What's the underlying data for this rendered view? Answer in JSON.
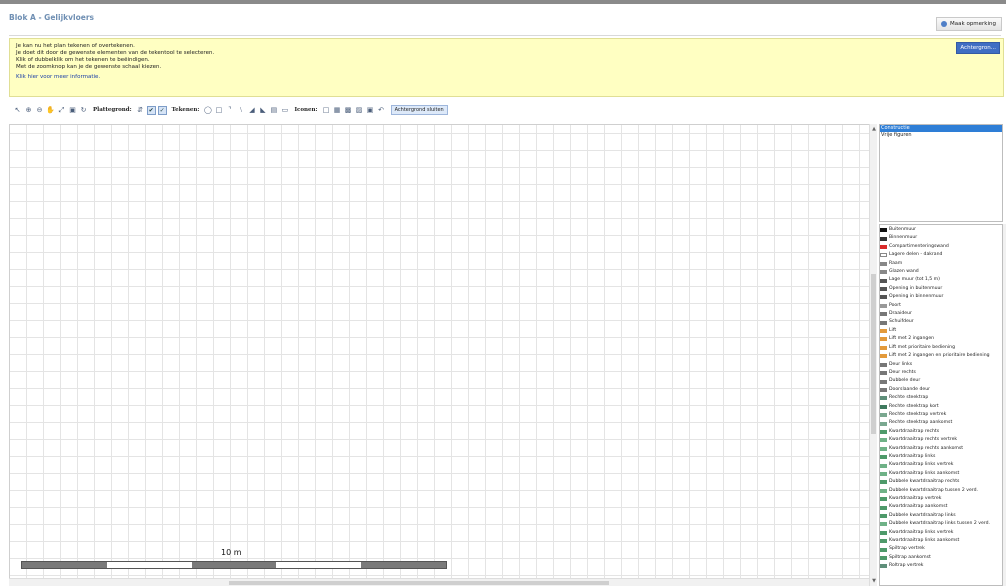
{
  "header": {
    "title": "Blok A - Gelijkvloers",
    "note_button": "Maak opmerking"
  },
  "info": {
    "lines": [
      "Je kan nu het plan tekenen of overtekenen.",
      "Je doet dit door de gewenste elementen van de tekentool te selecteren.",
      "Klik of dubbelklik om het tekenen te beëindigen.",
      "Met de zoomknop kan je de gewenste schaal kiezen."
    ],
    "more_link": "Klik hier voor meer informatie.",
    "background_button": "Achtergron..."
  },
  "toolbar": {
    "floorplan_label": "Plattegrond:",
    "draw_label": "Tekenen:",
    "icons_label": "Iconen:",
    "close_background_button": "Achtergrond sluiten"
  },
  "canvas": {
    "scale_label": "10 m"
  },
  "categories": [
    {
      "label": "Constructie",
      "selected": true
    },
    {
      "label": "Vrije figuren",
      "selected": false
    }
  ],
  "elements": [
    {
      "label": "Buitenmuur",
      "color": "#111111"
    },
    {
      "label": "Binnenmuur",
      "color": "#333333"
    },
    {
      "label": "Compartimenteringswand",
      "color": "#d92b2b"
    },
    {
      "label": "Lagere delen - dakrand",
      "color": "#ffffff"
    },
    {
      "label": "Raam",
      "color": "#888888"
    },
    {
      "label": "Glazen wand",
      "color": "#888888"
    },
    {
      "label": "Lage muur (tot 1,5 m)",
      "color": "#555555"
    },
    {
      "label": "Opening in buitenmuur",
      "color": "#555555"
    },
    {
      "label": "Opening in binnenmuur",
      "color": "#555555"
    },
    {
      "label": "Poort",
      "color": "#999999"
    },
    {
      "label": "Draaideur",
      "color": "#777777"
    },
    {
      "label": "Schuifdeur",
      "color": "#777777"
    },
    {
      "label": "Lift",
      "color": "#e39a3b"
    },
    {
      "label": "Lift met 2 ingangen",
      "color": "#e39a3b"
    },
    {
      "label": "Lift met prioritaire bediening",
      "color": "#e39a3b"
    },
    {
      "label": "Lift met 2 ingangen en prioritaire bediening",
      "color": "#e39a3b"
    },
    {
      "label": "Deur links",
      "color": "#777777"
    },
    {
      "label": "Deur rechts",
      "color": "#777777"
    },
    {
      "label": "Dubbele deur",
      "color": "#777777"
    },
    {
      "label": "Doorslaande deur",
      "color": "#777777"
    },
    {
      "label": "Rechte steektrap",
      "color": "#5f8f7a"
    },
    {
      "label": "Rechte steektrap kort",
      "color": "#3f7a5f"
    },
    {
      "label": "Rechte steektrap vertrek",
      "color": "#7aa890"
    },
    {
      "label": "Rechte steektrap aankomst",
      "color": "#7aa890"
    },
    {
      "label": "Kwartdraaitrap rechts",
      "color": "#4e9a6a"
    },
    {
      "label": "Kwartdraaitrap rechts vertrek",
      "color": "#6fb287"
    },
    {
      "label": "Kwartdraaitrap rechts aankomst",
      "color": "#6fb287"
    },
    {
      "label": "Kwartdraaitrap links",
      "color": "#4e9a6a"
    },
    {
      "label": "Kwartdraaitrap links vertrek",
      "color": "#6fb287"
    },
    {
      "label": "Kwartdraaitrap links aankomst",
      "color": "#6fb287"
    },
    {
      "label": "Dubbele kwartdraaitrap rechts",
      "color": "#4e9a6a"
    },
    {
      "label": "Dubbele kwartdraaitrap tussen 2 verd.",
      "color": "#6fb287"
    },
    {
      "label": "Kwartdraaitrap vertrek",
      "color": "#4e9a6a"
    },
    {
      "label": "Kwartdraaitrap aankomst",
      "color": "#4e9a6a"
    },
    {
      "label": "Dubbele kwartdraaitrap links",
      "color": "#4e9a6a"
    },
    {
      "label": "Dubbele kwartdraaitrap links tussen 2 verd.",
      "color": "#6fb287"
    },
    {
      "label": "Kwartdraaitrap links vertrek",
      "color": "#4e9a6a"
    },
    {
      "label": "Kwartdraaitrap links aankomst",
      "color": "#4e9a6a"
    },
    {
      "label": "Spiltrap vertrek",
      "color": "#4e9a6a"
    },
    {
      "label": "Spiltrap aankomst",
      "color": "#4e9a6a"
    },
    {
      "label": "Roltrap vertrek",
      "color": "#5f8f7a"
    }
  ]
}
